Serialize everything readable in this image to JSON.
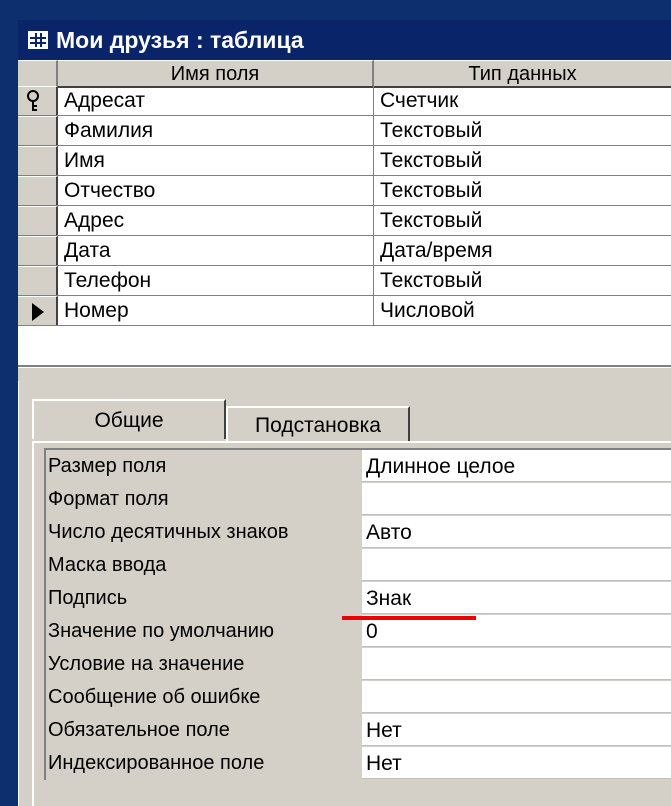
{
  "window": {
    "title": "Мои друзья : таблица",
    "icon": "table-icon"
  },
  "grid": {
    "headers": [
      "Имя поля",
      "Тип данных"
    ],
    "rows": [
      {
        "name": "Адресат",
        "type": "Счетчик",
        "indicator": "key-icon"
      },
      {
        "name": "Фамилия",
        "type": "Текстовый"
      },
      {
        "name": "Имя",
        "type": "Текстовый"
      },
      {
        "name": "Отчество",
        "type": "Текстовый"
      },
      {
        "name": "Адрес",
        "type": "Текстовый"
      },
      {
        "name": "Дата",
        "type": "Дата/время"
      },
      {
        "name": "Телефон",
        "type": "Текстовый"
      },
      {
        "name": "Номер",
        "type": "Числовой",
        "indicator": "current-row-arrow-icon"
      }
    ]
  },
  "tabs": [
    {
      "label": "Общие",
      "active": true
    },
    {
      "label": "Подстановка",
      "active": false
    }
  ],
  "properties": [
    {
      "label": "Размер поля",
      "value": "Длинное целое"
    },
    {
      "label": "Формат поля",
      "value": ""
    },
    {
      "label": "Число десятичных знаков",
      "value": "Авто"
    },
    {
      "label": "Маска ввода",
      "value": ""
    },
    {
      "label": "Подпись",
      "value": "Знак"
    },
    {
      "label": "Значение по умолчанию",
      "value": "0"
    },
    {
      "label": "Условие на значение",
      "value": ""
    },
    {
      "label": "Сообщение об ошибке",
      "value": ""
    },
    {
      "label": "Обязательное поле",
      "value": "Нет"
    },
    {
      "label": "Индексированное поле",
      "value": "Нет"
    }
  ],
  "colors": {
    "background": "#0d2f6e",
    "titlebar": "#0a246a",
    "window": "#d4d0c8",
    "annotation_line": "#ee0000"
  }
}
